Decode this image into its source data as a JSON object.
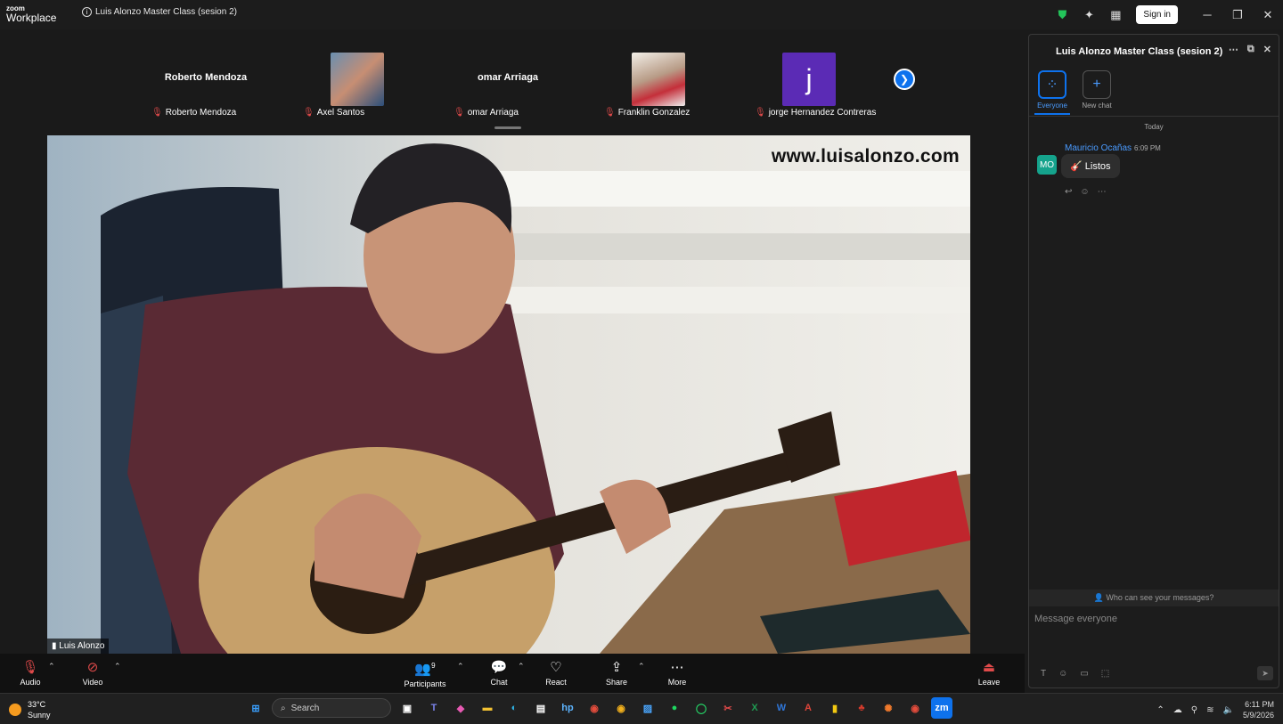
{
  "app": {
    "logo_line1": "zoom",
    "logo_line2": "Workplace",
    "meeting_title": "Luis Alonzo Master Class (sesion 2)",
    "sign_in": "Sign in"
  },
  "strip": {
    "tiles": [
      {
        "name_display": "Roberto Mendoza",
        "caption": "Roberto Mendoza"
      },
      {
        "name_display": "",
        "caption": "Axel Santos"
      },
      {
        "name_display": "omar Arriaga",
        "caption": "omar Arriaga"
      },
      {
        "name_display": "",
        "caption": "Franklin Gonzalez"
      },
      {
        "name_display": "",
        "avatar_letter": "j",
        "caption": "jorge Hernandez Contreras"
      }
    ]
  },
  "video": {
    "watermark": "www.luisalonzo.com",
    "speaker": "Luis Alonzo"
  },
  "toolbar": {
    "audio": "Audio",
    "video": "Video",
    "participants": "Participants",
    "participants_count": "9",
    "chat": "Chat",
    "react": "React",
    "share": "Share",
    "more": "More",
    "leave": "Leave"
  },
  "chat": {
    "title": "Luis Alonzo Master Class (sesion 2)",
    "tab_everyone": "Everyone",
    "tab_new": "New chat",
    "day": "Today",
    "messages": [
      {
        "initials": "MO",
        "author": "Mauricio Ocañas",
        "time": "6:09 PM",
        "text": "Listos",
        "emoji": "🎸"
      }
    ],
    "who_can_see": "Who can see your messages?",
    "placeholder": "Message everyone"
  },
  "taskbar": {
    "temp": "33°C",
    "condition": "Sunny",
    "search": "Search",
    "time": "6:11 PM",
    "date": "5/9/2026"
  },
  "colors": {
    "accent": "#0e72ed",
    "avatar_j": "#5b2bb5",
    "avatar_mo": "#15a38c",
    "muted": "#e04a4a"
  }
}
